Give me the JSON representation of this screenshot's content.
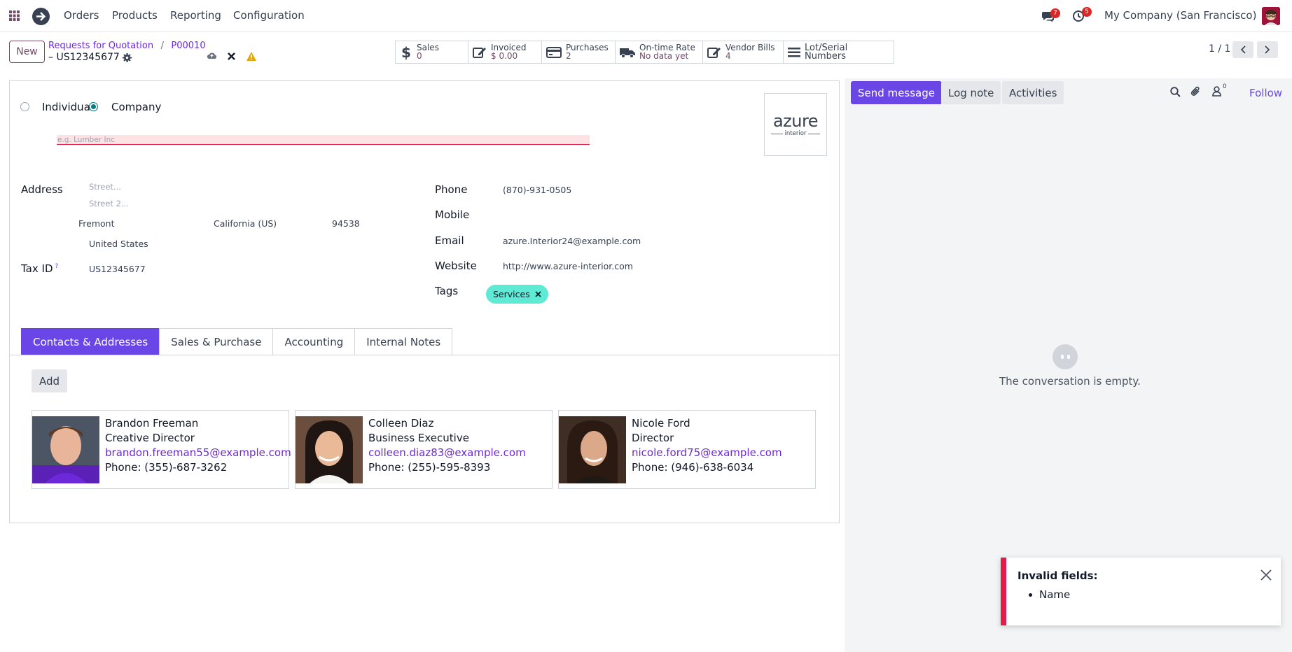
{
  "nav": {
    "items": [
      "Orders",
      "Products",
      "Reporting",
      "Configuration"
    ],
    "messages_count": "7",
    "activities_count": "5",
    "company": "My Company (San Francisco)"
  },
  "control": {
    "new_label": "New",
    "breadcrumb_parent": "Requests for Quotation",
    "breadcrumb_sep": "/",
    "breadcrumb_order": "P00010",
    "record_title": "– US12345677",
    "pager": "1 / 1"
  },
  "smart_buttons": [
    {
      "label": "Sales",
      "value": "0",
      "icon": "dollar-icon"
    },
    {
      "label": "Invoiced",
      "value": "$ 0.00",
      "icon": "edit-icon"
    },
    {
      "label": "Purchases",
      "value": "2",
      "icon": "credit-card-icon"
    },
    {
      "label": "On-time Rate",
      "value": "No data yet",
      "icon": "truck-icon"
    },
    {
      "label": "Vendor Bills",
      "value": "4",
      "icon": "edit-icon"
    },
    {
      "label": "Lot/Serial Numbers",
      "value": "",
      "icon": "bars-icon"
    }
  ],
  "form": {
    "type_individual": "Individual",
    "type_company": "Company",
    "name_placeholder": "e.g. Lumber Inc",
    "logo_text": "azure",
    "logo_sub": "interior",
    "address_label": "Address",
    "street_placeholder": "Street...",
    "street2_placeholder": "Street 2...",
    "city": "Fremont",
    "state": "California (US)",
    "zip": "94538",
    "country": "United States",
    "taxid_label": "Tax ID",
    "taxid_help": "?",
    "taxid": "US12345677",
    "phone_label": "Phone",
    "phone": "(870)-931-0505",
    "mobile_label": "Mobile",
    "email_label": "Email",
    "email": "azure.Interior24@example.com",
    "website_label": "Website",
    "website": "http://www.azure-interior.com",
    "tags_label": "Tags",
    "tag": "Services"
  },
  "tabs": [
    "Contacts & Addresses",
    "Sales & Purchase",
    "Accounting",
    "Internal Notes"
  ],
  "add_label": "Add",
  "contacts": [
    {
      "name": "Brandon Freeman",
      "function": "Creative Director",
      "email": "brandon.freeman55@example.com",
      "phone": "Phone: (355)-687-3262"
    },
    {
      "name": "Colleen Diaz",
      "function": "Business Executive",
      "email": "colleen.diaz83@example.com",
      "phone": "Phone: (255)-595-8393"
    },
    {
      "name": "Nicole Ford",
      "function": "Director",
      "email": "nicole.ford75@example.com",
      "phone": "Phone: (946)-638-6034"
    }
  ],
  "chatter": {
    "send_message": "Send message",
    "log_note": "Log note",
    "activities": "Activities",
    "followers_count": "0",
    "follow": "Follow",
    "empty": "The conversation is empty."
  },
  "toast": {
    "title": "Invalid fields:",
    "item": "Name"
  }
}
